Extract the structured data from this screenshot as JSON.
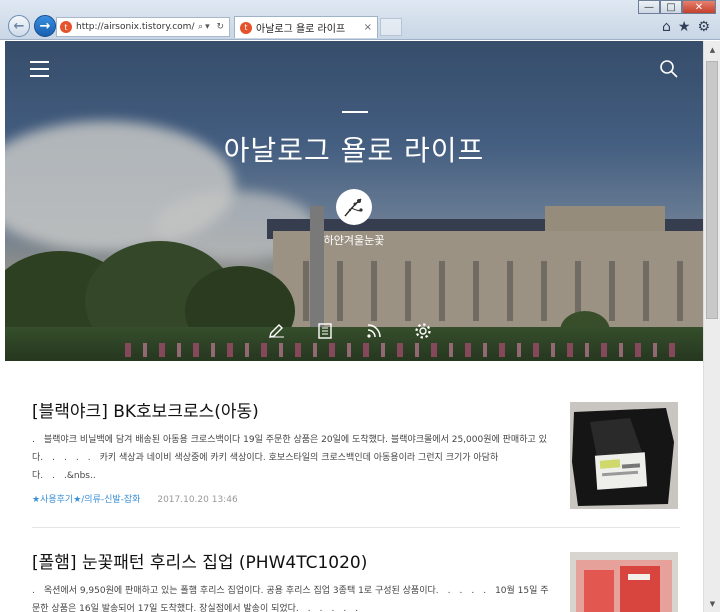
{
  "browser": {
    "url": "http://airsonix.tistory.com/",
    "tab_title": "아날로그 욜로 라이프",
    "tab_close": "×",
    "favicon_letter": "t",
    "addr_icons": "⌕▾ ↻",
    "window_controls": {
      "minimize": "—",
      "maximize": "□",
      "close": "✕"
    },
    "toolbar_icons": {
      "home": "⌂",
      "favorites": "★",
      "settings": "⚙"
    }
  },
  "blog": {
    "title": "아날로그 욜로 라이프",
    "author": "하얀겨울눈꽃"
  },
  "posts": [
    {
      "title": "[블랙야크] BK호보크로스(아동)",
      "excerpt": ".　블랙야크 비닐백에 담겨 배송된 아동용 크로스백이다 19일 주문한 상품은 20일에 도착했다. 블랙야크몰에서 25,000원에 판매하고 있다.　.　.　.　.　카키 색상과 네이비 색상중에 카키 색상이다. 호보스타일의 크로스백인데 아동용이라 그런지 크기가 아담하다.　.　.&nbs..",
      "category": "★사용후기★/의류-신발-잡화",
      "date": "2017.10.20 13:46"
    },
    {
      "title": "[폴햄] 눈꽃패턴 후리스 집업 (PHW4TC1020)",
      "excerpt": ".　옥션에서 9,950원에 판매하고 있는 폴햄 후리스 집업이다. 공용 후리스 집업 3종택 1로 구성된 상품이다.　.　.　.　.　10월 15일 주문한 상품은 16일 발송되어 17일 도착했다. 장실점에서 발송이 되었다.　.　.　.　.　.",
      "category": "",
      "date": ""
    }
  ],
  "colors": {
    "category_link": "#3a8fd6",
    "post_title": "#111111",
    "excerpt": "#444444",
    "meta": "#999999"
  }
}
